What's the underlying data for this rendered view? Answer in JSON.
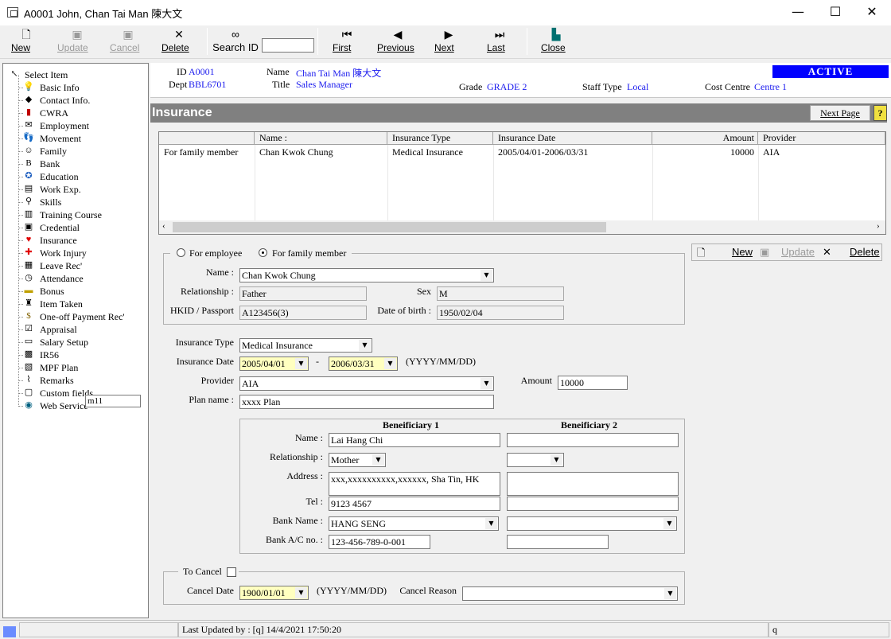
{
  "window": {
    "title": "A0001 John, Chan Tai Man 陳大文"
  },
  "toolbar": {
    "new": "New",
    "update": "Update",
    "cancel": "Cancel",
    "delete": "Delete",
    "search_id": "Search ID",
    "search_value": "",
    "first": "First",
    "previous": "Previous",
    "next": "Next",
    "last": "Last",
    "close": "Close"
  },
  "tree": {
    "root": "Select Item",
    "items": [
      {
        "label": "Basic Info",
        "icon": "lightbulb-icon",
        "glyph": "💡"
      },
      {
        "label": "Contact Info.",
        "icon": "contact-icon",
        "glyph": "◆"
      },
      {
        "label": "CWRA",
        "icon": "book-icon",
        "glyph": "▮"
      },
      {
        "label": "Employment",
        "icon": "envelope-icon",
        "glyph": "✉"
      },
      {
        "label": "Movement",
        "icon": "footprint-icon",
        "glyph": "👣"
      },
      {
        "label": "Family",
        "icon": "family-icon",
        "glyph": "☺"
      },
      {
        "label": "Bank",
        "icon": "bank-icon",
        "glyph": "B"
      },
      {
        "label": "Education",
        "icon": "education-icon",
        "glyph": "✪"
      },
      {
        "label": "Work Exp.",
        "icon": "document-icon",
        "glyph": "▤"
      },
      {
        "label": "Skills",
        "icon": "magnifier-icon",
        "glyph": "⚲"
      },
      {
        "label": "Training Course",
        "icon": "training-icon",
        "glyph": "▥"
      },
      {
        "label": "Credential",
        "icon": "credential-icon",
        "glyph": "▣"
      },
      {
        "label": "Insurance",
        "icon": "heart-icon",
        "glyph": "♥"
      },
      {
        "label": "Work Injury",
        "icon": "cross-icon",
        "glyph": "✚"
      },
      {
        "label": "Leave Rec'",
        "icon": "calendar-icon",
        "glyph": "▦"
      },
      {
        "label": "Attendance",
        "icon": "clock-icon",
        "glyph": "◷"
      },
      {
        "label": "Bonus",
        "icon": "bonus-icon",
        "glyph": "▬"
      },
      {
        "label": "Item Taken",
        "icon": "item-icon",
        "glyph": "♜"
      },
      {
        "label": "One-off Payment Rec'",
        "icon": "dollar-icon",
        "glyph": "$"
      },
      {
        "label": "Appraisal",
        "icon": "checklist-icon",
        "glyph": "☑"
      },
      {
        "label": "Salary Setup",
        "icon": "salary-icon",
        "glyph": "▭"
      },
      {
        "label": "IR56",
        "icon": "ir56-icon",
        "glyph": "▩"
      },
      {
        "label": "MPF Plan",
        "icon": "mpf-icon",
        "glyph": "▧"
      },
      {
        "label": "Remarks",
        "icon": "paperclip-icon",
        "glyph": "⌇"
      },
      {
        "label": "Custom fields",
        "icon": "custom-icon",
        "glyph": "▢"
      },
      {
        "label": "Web Service",
        "icon": "globe-icon",
        "glyph": "◉"
      }
    ],
    "edit_value": "m11"
  },
  "header": {
    "id_label": "ID",
    "id_value": "A0001",
    "dept_label": "Dept",
    "dept_value": "BBL6701",
    "name_label": "Name",
    "name_value": "Chan Tai Man 陳大文",
    "title_label": "Title",
    "title_value": "Sales Manager",
    "grade_label": "Grade",
    "grade_value": "GRADE 2",
    "staff_type_label": "Staff Type",
    "staff_type_value": "Local",
    "cost_centre_label": "Cost Centre",
    "cost_centre_value": "Centre 1",
    "status": "ACTIVE"
  },
  "section": {
    "title": "Insurance",
    "next_page": "Next Page",
    "help": "?"
  },
  "grid": {
    "columns": [
      "",
      "Name :",
      "Insurance Type",
      "Insurance Date",
      "Amount",
      "Provider"
    ],
    "rows": [
      [
        "For family member",
        "Chan Kwok Chung",
        "Medical Insurance",
        "2005/04/01-2006/03/31",
        "10000",
        "AIA"
      ]
    ]
  },
  "form": {
    "for_employee": "For employee",
    "for_family": "For family member",
    "name_label": "Name :",
    "name_value": "Chan Kwok Chung",
    "relationship_label": "Relationship :",
    "relationship_value": "Father",
    "sex_label": "Sex",
    "sex_value": "M",
    "hkid_label": "HKID / Passport",
    "hkid_value": "A123456(3)",
    "dob_label": "Date of birth :",
    "dob_value": "1950/02/04",
    "ins_type_label": "Insurance Type",
    "ins_type_value": "Medical Insurance",
    "ins_date_label": "Insurance Date",
    "ins_date_from": "2005/04/01",
    "ins_date_dash": "-",
    "ins_date_to": "2006/03/31",
    "date_format": "(YYYY/MM/DD)",
    "provider_label": "Provider",
    "provider_value": "AIA",
    "amount_label": "Amount",
    "amount_value": "10000",
    "plan_label": "Plan name :",
    "plan_value": "xxxx Plan"
  },
  "beneficiary": {
    "b1_title": "Beneificiary 1",
    "b2_title": "Beneificiary 2",
    "name_label": "Name :",
    "relationship_label": "Relationship :",
    "address_label": "Address :",
    "tel_label": "Tel :",
    "bank_name_label": "Bank Name :",
    "bank_ac_label": "Bank A/C no. :",
    "b1_name": "Lai Hang Chi",
    "b1_relationship": "Mother",
    "b1_address": "xxx,xxxxxxxxxx,xxxxxx, Sha Tin, HK",
    "b1_tel": "9123 4567",
    "b1_bank_name": "HANG SENG",
    "b1_bank_ac": "123-456-789-0-001",
    "b2_name": "",
    "b2_relationship": "",
    "b2_address": "",
    "b2_tel": "",
    "b2_bank_name": "",
    "b2_bank_ac": ""
  },
  "cancel_section": {
    "to_cancel_label": "To Cancel",
    "cancel_date_label": "Cancel Date",
    "cancel_date_value": "1900/01/01",
    "date_format": "(YYYY/MM/DD)",
    "cancel_reason_label": "Cancel Reason",
    "cancel_reason_value": ""
  },
  "right_toolbar": {
    "new": "New",
    "update": "Update",
    "delete": "Delete"
  },
  "status_bar": {
    "last_updated": "Last Updated by : [q]  14/4/2021 17:50:20",
    "user": "q"
  }
}
